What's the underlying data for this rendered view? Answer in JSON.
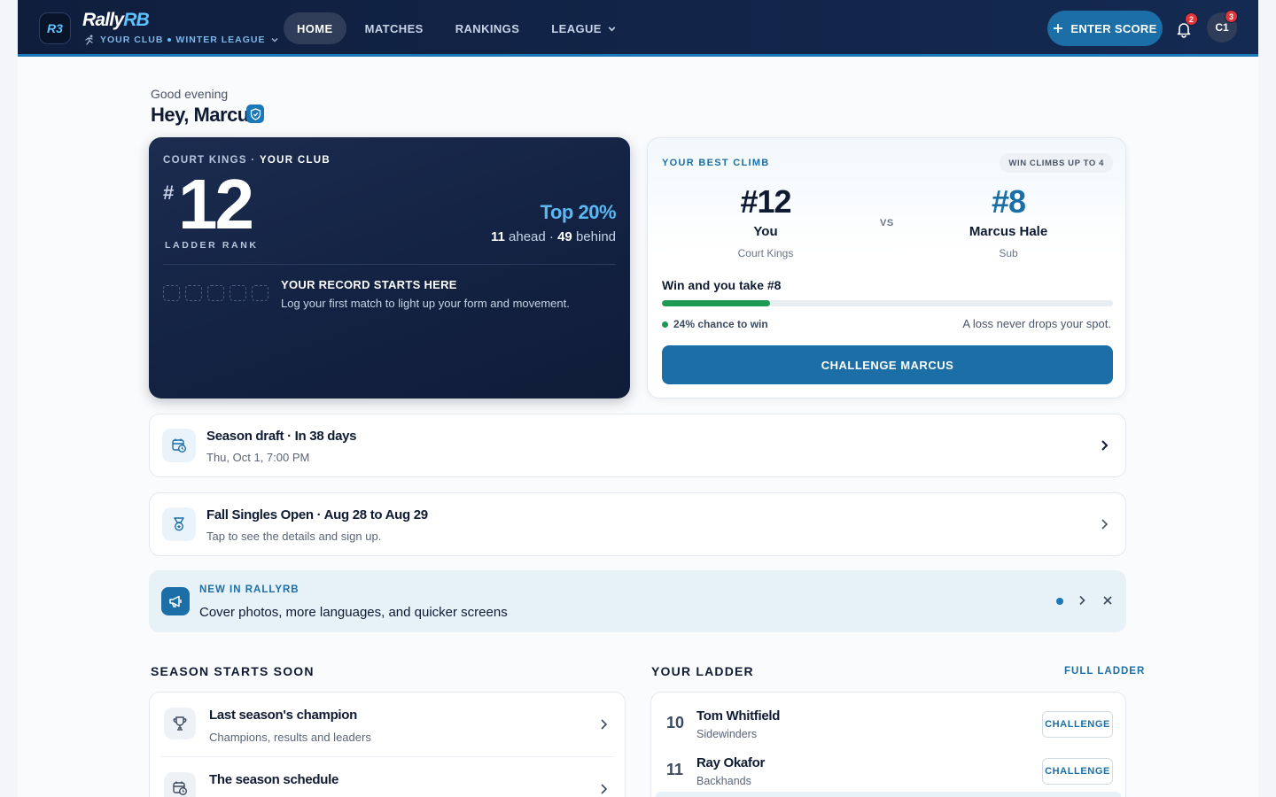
{
  "header": {
    "logo_mark": "R3",
    "brand_primary": "Rally",
    "brand_accent": "RB",
    "club": "YOUR CLUB",
    "league": "WINTER LEAGUE",
    "nav": [
      {
        "label": "HOME",
        "active": true
      },
      {
        "label": "MATCHES",
        "active": false
      },
      {
        "label": "RANKINGS",
        "active": false
      },
      {
        "label": "LEAGUE",
        "active": false
      }
    ],
    "enter_score": "ENTER SCORE",
    "notifications_count": "2",
    "avatar_initials": "C1",
    "avatar_badge": "3"
  },
  "greeting": {
    "time_of_day": "Good evening",
    "name": "Hey, Marcus"
  },
  "rank_card": {
    "team": "COURT KINGS",
    "club": "YOUR CLUB",
    "hash": "#",
    "rank": "12",
    "rank_label": "LADDER RANK",
    "top_percent": "Top 20%",
    "ahead_count": "11",
    "ahead_label": "ahead",
    "behind_count": "49",
    "behind_label": "behind",
    "record_title": "YOUR RECORD STARTS HERE",
    "record_sub": "Log your first match to light up your form and movement."
  },
  "climb_card": {
    "eyebrow": "YOUR BEST CLIMB",
    "pill": "WIN CLIMBS UP TO 4",
    "you_rank": "#12",
    "you_name": "You",
    "you_team": "Court Kings",
    "vs": "VS",
    "opp_rank": "#8",
    "opp_name": "Marcus Hale",
    "opp_team": "Sub",
    "take_text": "Win and you take #8",
    "win_chance": 0.24,
    "chance_text": "24% chance to win",
    "loss_text": "A loss never drops your spot.",
    "button": "CHALLENGE MARCUS"
  },
  "events": [
    {
      "title": "Season draft · In 38 days",
      "sub": "Thu, Oct 1, 7:00 PM",
      "icon": "calendar-clock-icon"
    },
    {
      "title": "Fall Singles Open · Aug 28 to Aug 29",
      "sub": "Tap to see the details and sign up.",
      "icon": "medal-icon"
    }
  ],
  "news": {
    "eyebrow": "NEW IN RALLYRB",
    "text": "Cover photos, more languages, and quicker screens"
  },
  "season": {
    "title": "SEASON STARTS SOON",
    "items": [
      {
        "title": "Last season's champion",
        "sub": "Champions, results and leaders",
        "icon": "trophy-icon"
      },
      {
        "title": "The season schedule",
        "sub": "",
        "icon": "calendar-clock-icon"
      }
    ]
  },
  "ladder": {
    "title": "YOUR LADDER",
    "link": "FULL LADDER",
    "rows": [
      {
        "rank": "10",
        "name": "Tom Whitfield",
        "team": "Sidewinders",
        "action": "CHALLENGE"
      },
      {
        "rank": "11",
        "name": "Ray Okafor",
        "team": "Backhands",
        "action": "CHALLENGE"
      }
    ]
  },
  "colors": {
    "navy": "#132242",
    "accent": "#1b6fa6",
    "success": "#1f9a55",
    "alert": "#e0353b"
  }
}
